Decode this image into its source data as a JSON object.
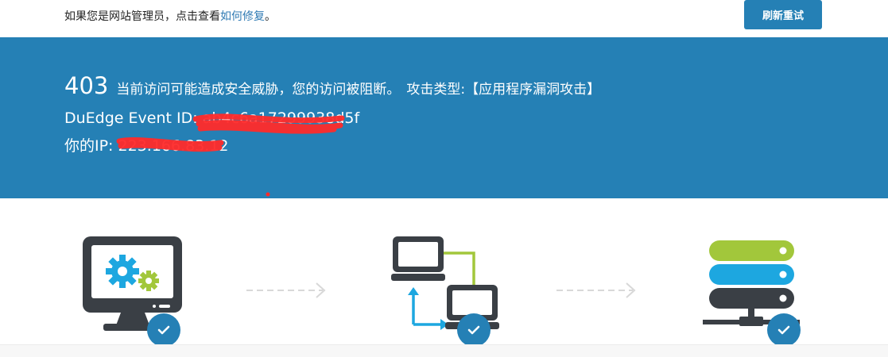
{
  "topbar": {
    "notice_prefix": "如果您是网站管理员，点击查看",
    "notice_link": "如何修复",
    "notice_suffix": "。",
    "refresh_button": "刷新重试"
  },
  "banner": {
    "status_code": "403",
    "message": "当前访问可能造成安全威胁，您的访问被阻断。",
    "attack_type": "攻击类型:【应用程序漏洞攻击】",
    "event_id_label": "DuEdge Event ID: ",
    "event_id_value": "ab4c6a17299938d5f",
    "ip_label": "你的IP: ",
    "ip_value": "223.166.83.12"
  },
  "icons": {
    "step1": "computer-gears-icon",
    "step2": "network-computers-icon",
    "step3": "server-stack-icon",
    "check": "check-icon",
    "arrow": "dashed-arrow-icon"
  },
  "colors": {
    "brand_blue": "#2580b5",
    "dark": "#3a3f45",
    "gear_blue": "#1da7e0",
    "gear_green": "#a2c73b",
    "redaction": "#ff2a2a"
  }
}
